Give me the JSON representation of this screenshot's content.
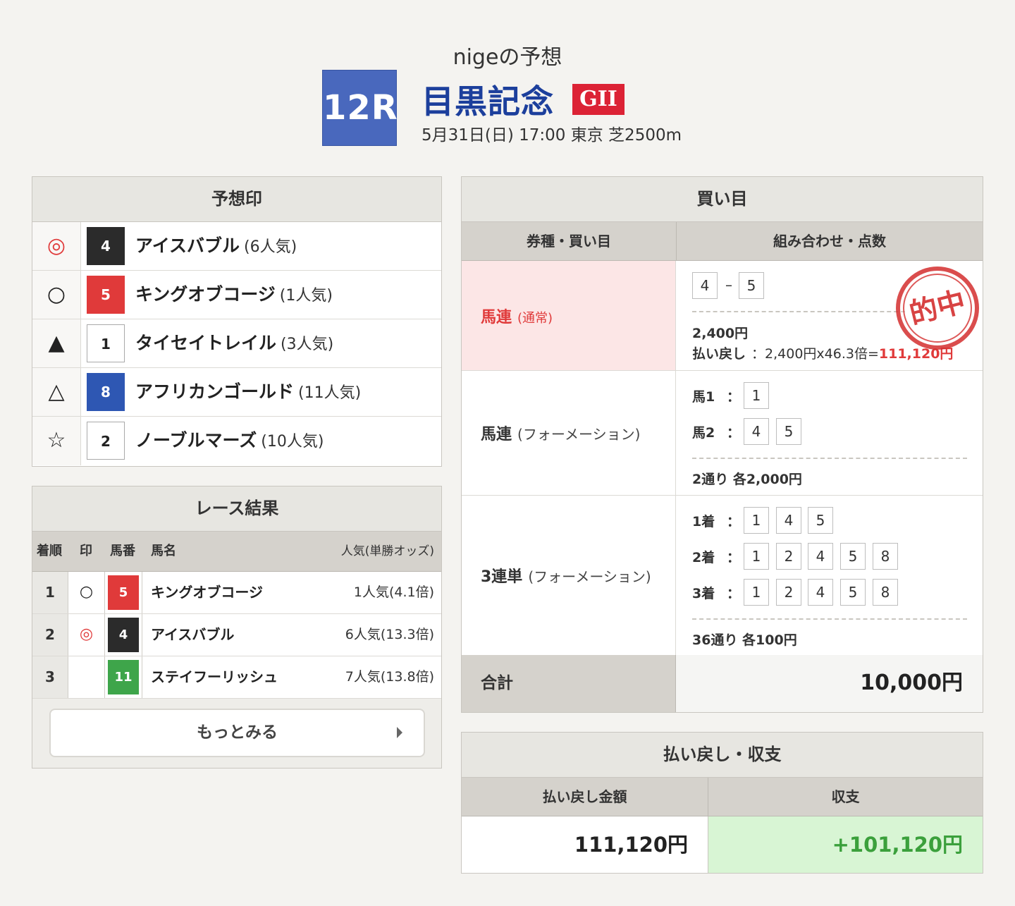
{
  "header": {
    "user_title": "nigeの予想",
    "race_number": "12R",
    "race_name": "目黒記念",
    "grade": "GII",
    "race_info": "5月31日(日) 17:00 東京 芝2500m"
  },
  "prediction": {
    "title": "予想印",
    "rows": [
      {
        "mark": "◎",
        "number": "4",
        "name": "アイスバブル",
        "popularity": "(6人気)"
      },
      {
        "mark": "○",
        "number": "5",
        "name": "キングオブコージ",
        "popularity": "(1人気)"
      },
      {
        "mark": "▲",
        "number": "1",
        "name": "タイセイトレイル",
        "popularity": "(3人気)"
      },
      {
        "mark": "△",
        "number": "8",
        "name": "アフリカンゴールド",
        "popularity": "(11人気)"
      },
      {
        "mark": "☆",
        "number": "2",
        "name": "ノーブルマーズ",
        "popularity": "(10人気)"
      }
    ]
  },
  "result": {
    "title": "レース結果",
    "headers": {
      "rank": "着順",
      "mark": "印",
      "number": "馬番",
      "name": "馬名",
      "popularity": "人気(単勝オッズ)"
    },
    "rows": [
      {
        "rank": "1",
        "mark": "○",
        "number": "5",
        "name": "キングオブコージ",
        "popularity": "1人気(4.1倍)"
      },
      {
        "rank": "2",
        "mark": "◎",
        "number": "4",
        "name": "アイスバブル",
        "popularity": "6人気(13.3倍)"
      },
      {
        "rank": "3",
        "mark": "",
        "number": "11",
        "name": "ステイフーリッシュ",
        "popularity": "7人気(13.8倍)"
      }
    ],
    "more_label": "もっとみる"
  },
  "buy": {
    "title": "買い目",
    "col1": "券種・買い目",
    "col2": "組み合わせ・点数",
    "bets": [
      {
        "type": "馬連",
        "sub": "(通常)",
        "combo": [
          "4",
          "5"
        ],
        "combo_sep": "–",
        "amount": "2,400円",
        "payout_label": "払い戻し",
        "payout_calc": "：2,400円x46.3倍=",
        "payout_value": "111,120円",
        "stamp": "的中"
      },
      {
        "type": "馬連",
        "sub": "(フォーメーション)",
        "legs": [
          {
            "label": "馬1",
            "numbers": [
              "1"
            ]
          },
          {
            "label": "馬2",
            "numbers": [
              "4",
              "5"
            ]
          }
        ],
        "summary": "2通り 各2,000円"
      },
      {
        "type": "3連単",
        "sub": "(フォーメーション)",
        "legs": [
          {
            "label": "1着",
            "numbers": [
              "1",
              "4",
              "5"
            ]
          },
          {
            "label": "2着",
            "numbers": [
              "1",
              "2",
              "4",
              "5",
              "8"
            ]
          },
          {
            "label": "3着",
            "numbers": [
              "1",
              "2",
              "4",
              "5",
              "8"
            ]
          }
        ],
        "summary": "36通り 各100円"
      }
    ],
    "colon": "：",
    "total_label": "合計",
    "total_value": "10,000円"
  },
  "payout": {
    "title": "払い戻し・収支",
    "col1": "払い戻し金額",
    "col2": "収支",
    "amount": "111,120円",
    "balance": "+101,120円"
  },
  "colors": {
    "race_badge": "#4968bd",
    "race_name": "#1c3f9c",
    "grade": "#dc2235",
    "hit": "#e03a3a",
    "profit": "#3ba03c"
  }
}
